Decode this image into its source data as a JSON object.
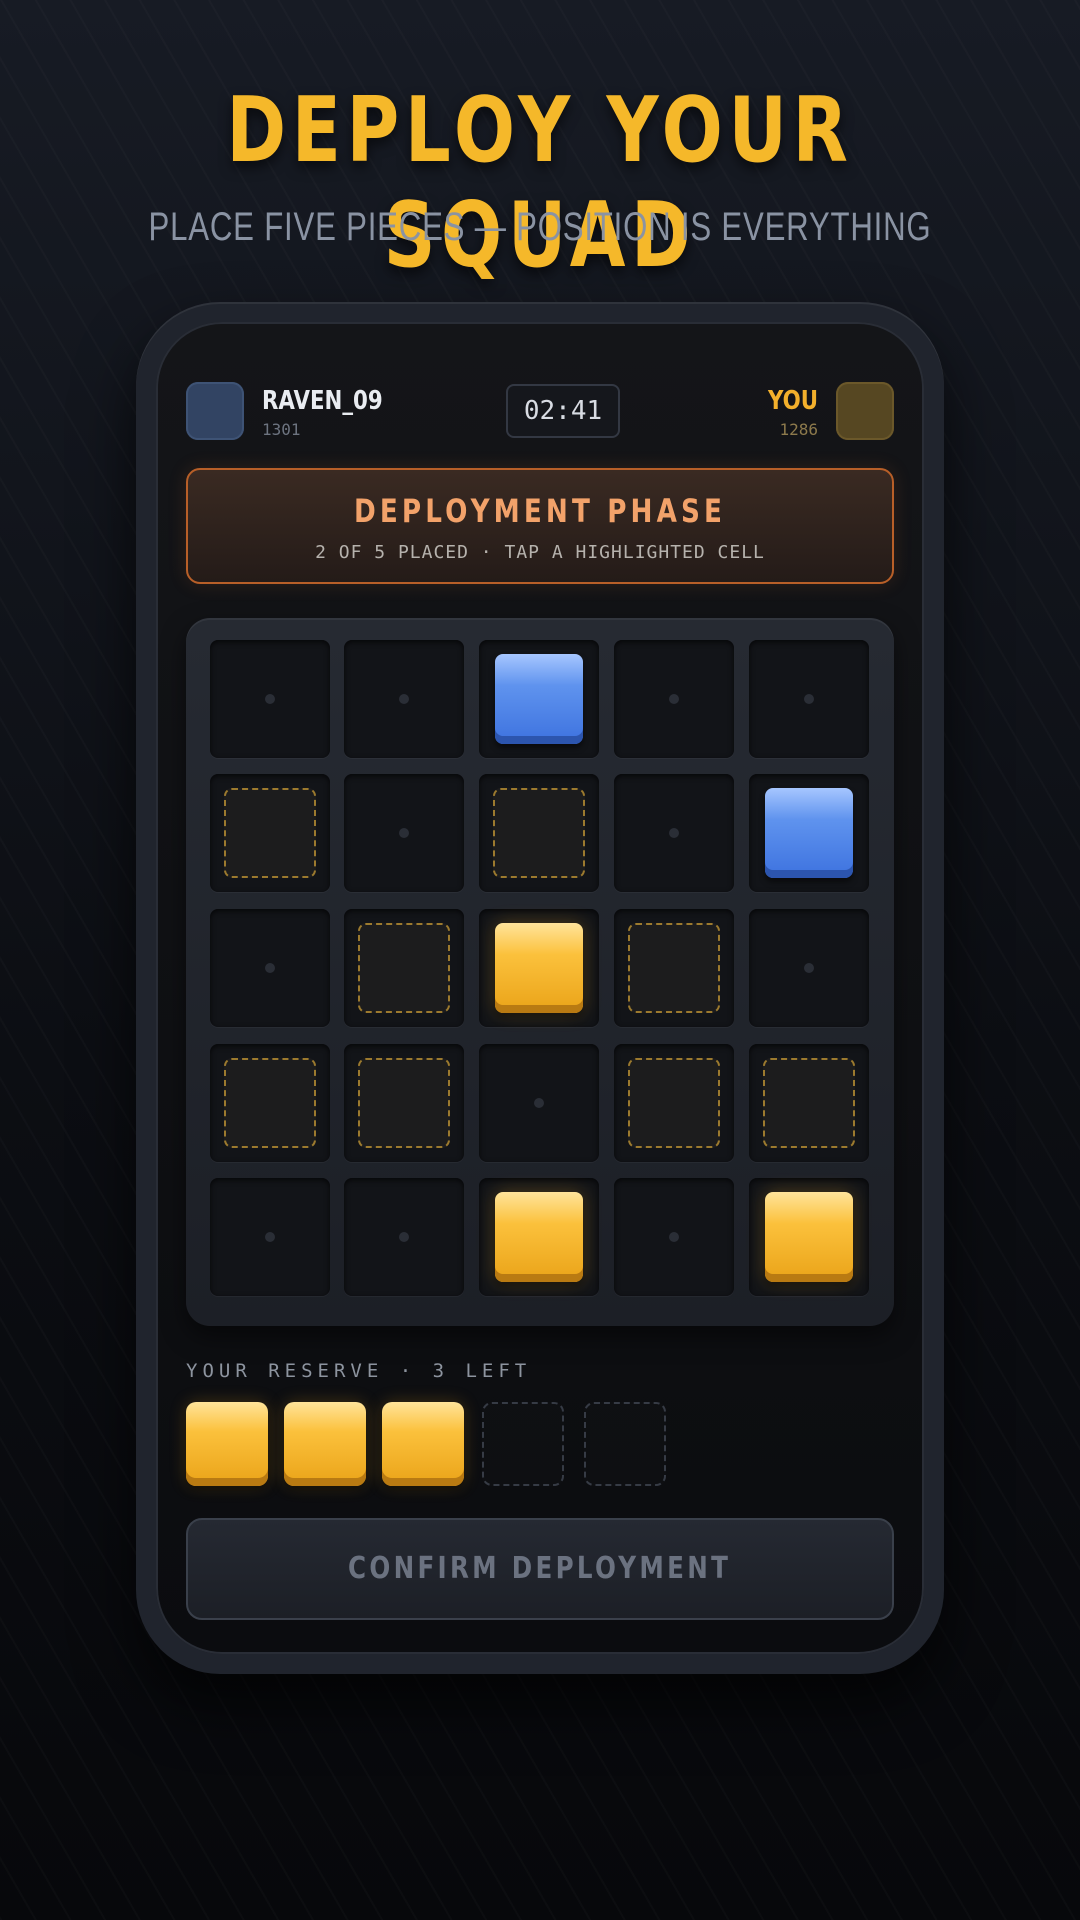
{
  "header": {
    "title": "DEPLOY YOUR SQUAD",
    "subtitle": "PLACE FIVE PIECES — POSITION IS EVERYTHING"
  },
  "opponent": {
    "name": "RAVEN_09",
    "rating": "1301",
    "color": "#324463"
  },
  "player": {
    "name": "YOU",
    "rating": "1286",
    "color": "#564722"
  },
  "timer": "02:41",
  "phase": {
    "title": "DEPLOYMENT PHASE",
    "subtitle": "2 OF 5 PLACED · TAP A HIGHLIGHTED CELL",
    "placed": 2,
    "total": 5
  },
  "board": {
    "size": 5,
    "rows": [
      [
        "empty",
        "empty",
        "blue",
        "empty",
        "empty"
      ],
      [
        "highlight",
        "empty",
        "highlight",
        "empty",
        "blue"
      ],
      [
        "empty",
        "highlight",
        "gold",
        "highlight",
        "empty"
      ],
      [
        "highlight",
        "highlight",
        "empty",
        "highlight",
        "highlight"
      ],
      [
        "empty",
        "empty",
        "gold",
        "empty",
        "gold"
      ]
    ],
    "colors": {
      "blue": "#4a7fe6",
      "gold": "#f5b82a",
      "highlight": "#9c7a2e"
    }
  },
  "reserve": {
    "label": "YOUR RESERVE · 3 LEFT",
    "slots": [
      "gold",
      "gold",
      "gold",
      "empty",
      "empty"
    ]
  },
  "confirm_label": "CONFIRM DEPLOYMENT"
}
